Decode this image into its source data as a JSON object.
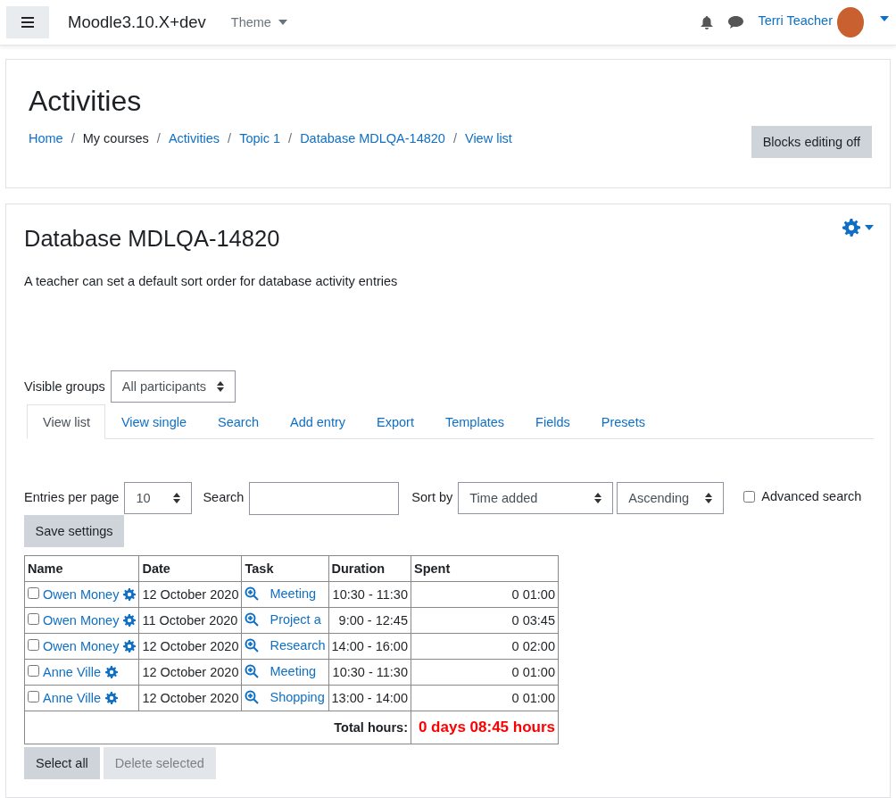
{
  "navbar": {
    "site_name": "Moodle3.10.X+dev",
    "theme_menu": "Theme",
    "user_name": "Terri Teacher"
  },
  "header": {
    "title": "Activities",
    "separator": "/",
    "breadcrumbs": [
      {
        "label": "Home",
        "link": true
      },
      {
        "label": "My courses",
        "link": false
      },
      {
        "label": "Activities",
        "link": true
      },
      {
        "label": "Topic 1",
        "link": true
      },
      {
        "label": "Database MDLQA-14820",
        "link": true
      },
      {
        "label": "View list",
        "link": true
      }
    ],
    "button": "Blocks editing off"
  },
  "main": {
    "title": "Database MDLQA-14820",
    "description": "A teacher can set a default sort order for database activity entries",
    "groups": {
      "label": "Visible groups",
      "value": "All participants"
    },
    "tabs": [
      {
        "label": "View list",
        "selected": true
      },
      {
        "label": "View single",
        "selected": false
      },
      {
        "label": "Search",
        "selected": false
      },
      {
        "label": "Add entry",
        "selected": false
      },
      {
        "label": "Export",
        "selected": false
      },
      {
        "label": "Templates",
        "selected": false
      },
      {
        "label": "Fields",
        "selected": false
      },
      {
        "label": "Presets",
        "selected": false
      }
    ],
    "filters": {
      "entries_label": "Entries per page",
      "entries_value": "10",
      "search_label": "Search",
      "sort_label": "Sort by",
      "sort_value": "Time added",
      "order_value": "Ascending",
      "advanced_label": "Advanced search",
      "advanced_checked": false,
      "save_button": "Save settings"
    },
    "table": {
      "columns": [
        "Name",
        "Date",
        "Task",
        "Duration",
        "Spent"
      ],
      "rows": [
        {
          "checked": false,
          "name": "Owen Money",
          "date": "12 October 2020",
          "task": "Meeting",
          "duration": "10:30 - 11:30",
          "spent": "0 01:00"
        },
        {
          "checked": false,
          "name": "Owen Money",
          "date": "11 October 2020",
          "task": "Project a",
          "duration": "9:00 - 12:45",
          "spent": "0 03:45"
        },
        {
          "checked": false,
          "name": "Owen Money",
          "date": "12 October 2020",
          "task": "Research",
          "duration": "14:00 - 16:00",
          "spent": "0 02:00"
        },
        {
          "checked": false,
          "name": "Anne Ville",
          "date": "12 October 2020",
          "task": "Meeting",
          "duration": "10:30 - 11:30",
          "spent": "0 01:00"
        },
        {
          "checked": false,
          "name": "Anne Ville",
          "date": "12 October 2020",
          "task": "Shopping",
          "duration": "13:00 - 14:00",
          "spent": "0 01:00"
        }
      ],
      "total_label": "Total hours:",
      "total_value": "0 days 08:45 hours"
    },
    "actions": [
      {
        "label": "Select all",
        "disabled": false
      },
      {
        "label": "Delete selected",
        "disabled": true
      }
    ]
  }
}
